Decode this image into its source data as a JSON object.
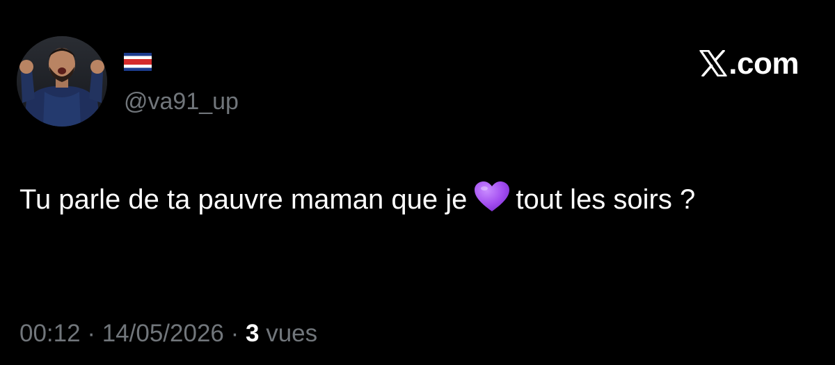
{
  "author": {
    "handle": "@va91_up",
    "flag_icon": "costa-rica-flag-icon",
    "avatar_icon": "profile-photo-avatar"
  },
  "brand": {
    "label": ".com",
    "logo_icon": "x-logo-icon"
  },
  "tweet": {
    "text_before_emoji": "Tu parle de ta pauvre maman que je",
    "emoji_icon": "purple-heart-icon",
    "text_after_emoji": "tout les soirs ?"
  },
  "meta": {
    "time": "00:12",
    "separator": "·",
    "date": "14/05/2026",
    "views_count": "3",
    "views_label": "vues"
  },
  "colors": {
    "background": "#000000",
    "text_primary": "#ffffff",
    "text_secondary": "#71767b",
    "emoji_purple": "#a24cf0"
  }
}
